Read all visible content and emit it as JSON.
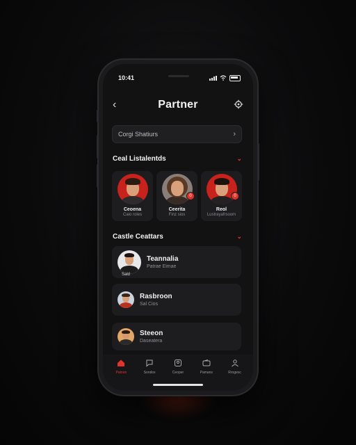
{
  "status_bar": {
    "time": "10:41"
  },
  "header": {
    "title": "Partner"
  },
  "search": {
    "label": "Corgi Shatiurs"
  },
  "section1": {
    "title": "Ceal Listalentds",
    "cards": [
      {
        "name": "Ceoena",
        "sub": "Caio roles",
        "badge": ""
      },
      {
        "name": "Ceerita",
        "sub": "Finz sios",
        "badge": "0"
      },
      {
        "name": "Reol",
        "sub": "Lustrayafrsoom",
        "badge": "0"
      }
    ]
  },
  "section2": {
    "title": "Castle Ceattars",
    "items": [
      {
        "title": "Teannalia",
        "sub": "Patrae Eimae",
        "caption": "Sald"
      },
      {
        "title": "Rasbroon",
        "sub": "Sal Cios"
      },
      {
        "title": "Steeon",
        "sub": "Daseatera"
      }
    ]
  },
  "tabbar": {
    "tabs": [
      {
        "label": "Patnon",
        "icon": "home-icon",
        "active": true
      },
      {
        "label": "Sondox",
        "icon": "chat-icon",
        "active": false
      },
      {
        "label": "Ceoper",
        "icon": "profile-icon",
        "active": false
      },
      {
        "label": "Pamans",
        "icon": "wallet-icon",
        "active": false
      },
      {
        "label": "Rrogesc",
        "icon": "user-icon",
        "active": false
      }
    ]
  },
  "colors": {
    "accent": "#e0342a",
    "background": "#121213",
    "card": "#1d1d20"
  }
}
